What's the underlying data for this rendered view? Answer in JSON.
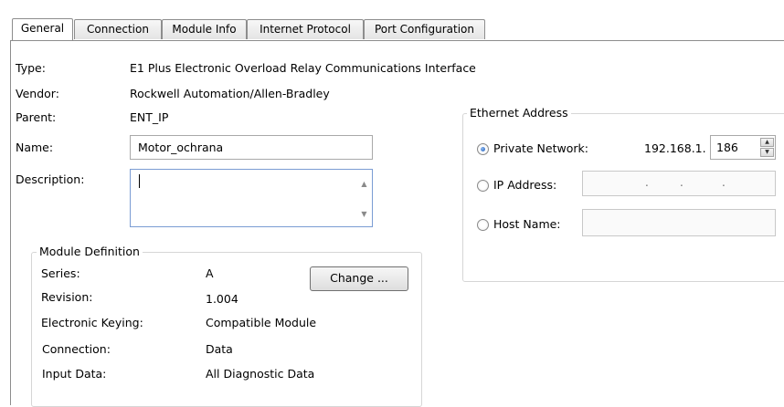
{
  "tabs": [
    {
      "label": "General",
      "active": true
    },
    {
      "label": "Connection",
      "active": false
    },
    {
      "label": "Module Info",
      "active": false
    },
    {
      "label": "Internet Protocol",
      "active": false
    },
    {
      "label": "Port Configuration",
      "active": false
    }
  ],
  "general": {
    "type_label": "Type:",
    "type_value": "E1 Plus Electronic Overload Relay Communications Interface",
    "vendor_label": "Vendor:",
    "vendor_value": "Rockwell Automation/Allen-Bradley",
    "parent_label": "Parent:",
    "parent_value": "ENT_IP",
    "name_label": "Name:",
    "name_value": "Motor_ochrana",
    "description_label": "Description:",
    "description_value": ""
  },
  "module_definition": {
    "title": "Module Definition",
    "series_label": "Series:",
    "series_value": "A",
    "revision_label": "Revision:",
    "revision_value": "1.004",
    "keying_label": "Electronic Keying:",
    "keying_value": "Compatible Module",
    "connection_label": "Connection:",
    "connection_value": "Data",
    "input_label": "Input Data:",
    "input_value": "All Diagnostic Data",
    "change_button": "Change ..."
  },
  "ethernet": {
    "title": "Ethernet Address",
    "private_label": "Private Network:",
    "private_prefix": "192.168.1.",
    "private_octet": "186",
    "ip_label": "IP Address:",
    "host_label": "Host Name:",
    "selected": "private"
  },
  "icons": {
    "scroll_up": "▲",
    "scroll_down": "▼",
    "spin_up": "▲",
    "spin_down": "▼",
    "ip_dot": "."
  }
}
